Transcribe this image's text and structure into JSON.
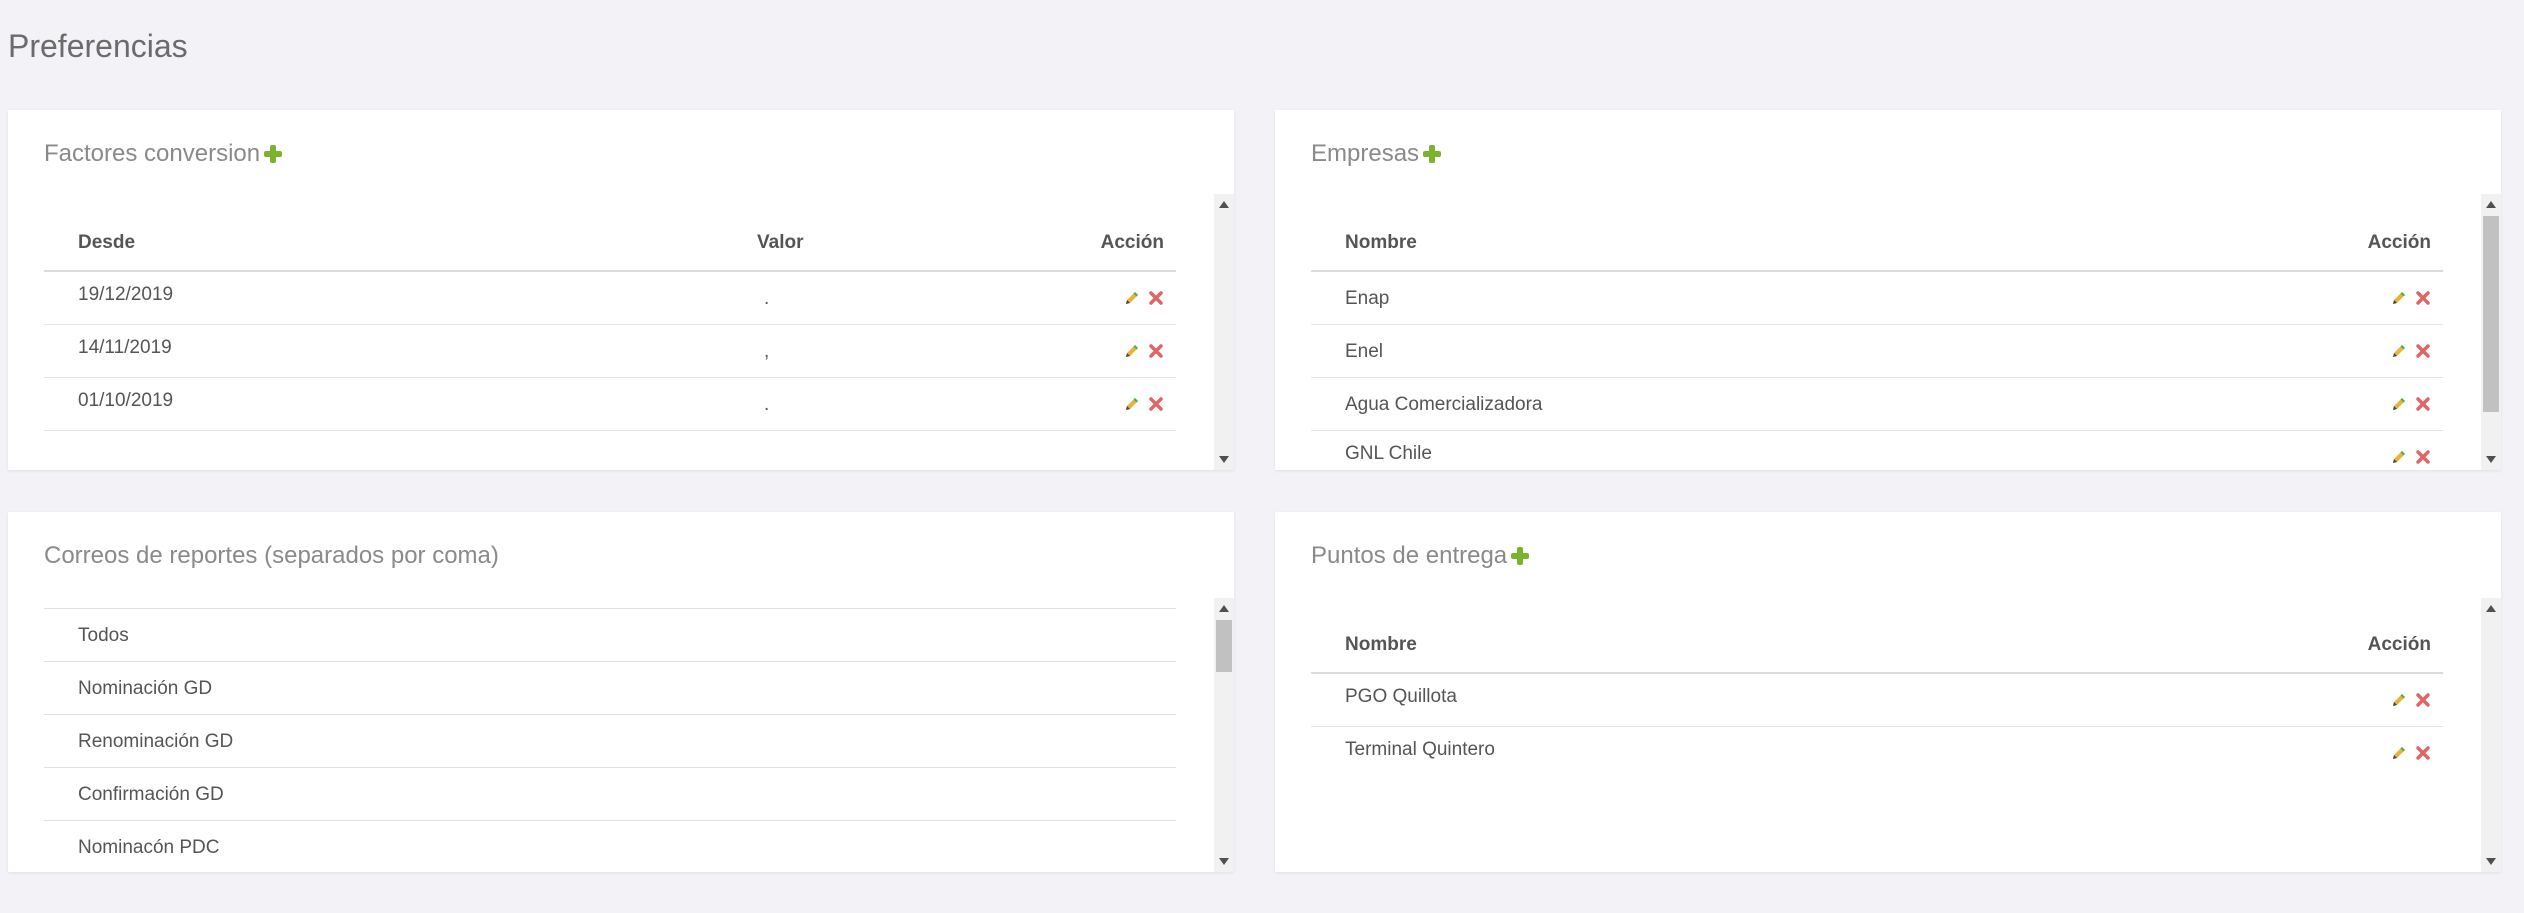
{
  "page": {
    "title": "Preferencias"
  },
  "factores": {
    "title": "Factores conversion",
    "headers": {
      "desde": "Desde",
      "valor": "Valor",
      "accion": "Acción"
    },
    "rows": [
      {
        "desde": "19/12/2019",
        "valor": "."
      },
      {
        "desde": "14/11/2019",
        "valor": ","
      },
      {
        "desde": "01/10/2019",
        "valor": "."
      }
    ]
  },
  "empresas": {
    "title": "Empresas",
    "headers": {
      "nombre": "Nombre",
      "accion": "Acción"
    },
    "rows": [
      {
        "nombre": "Enap"
      },
      {
        "nombre": "Enel"
      },
      {
        "nombre": "Agua Comercializadora"
      },
      {
        "nombre": "GNL Chile"
      }
    ]
  },
  "correos": {
    "title": "Correos de reportes (separados por coma)",
    "items": [
      "Todos",
      "Nominación GD",
      "Renominación GD",
      "Confirmación GD",
      "Nominacón PDC"
    ]
  },
  "puntos": {
    "title": "Puntos de entrega",
    "headers": {
      "nombre": "Nombre",
      "accion": "Acción"
    },
    "rows": [
      {
        "nombre": "PGO Quillota"
      },
      {
        "nombre": "Terminal Quintero"
      }
    ]
  },
  "icons": {
    "add": "plus-icon",
    "edit": "pencil-icon",
    "delete": "x-icon",
    "add_color": "#7cb32e",
    "delete_color": "#e06666"
  }
}
